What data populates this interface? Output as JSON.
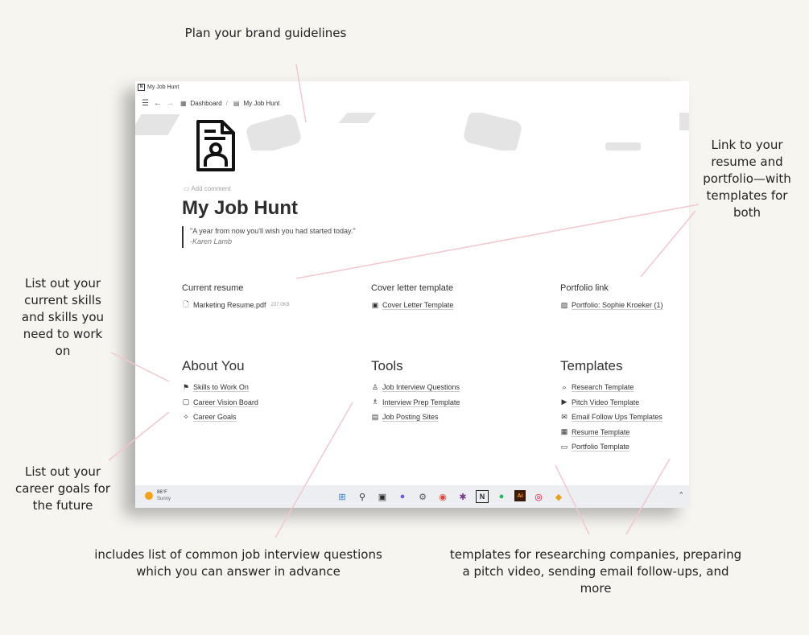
{
  "annotations": {
    "brand": "Plan your brand guidelines",
    "resume_link": "Link to your resume and portfolio—with templates for both",
    "skills": "List out your current skills and skills you need to work on",
    "goals": "List out your career goals for the future",
    "interview": "includes list of common job interview questions which you can answer in advance",
    "templates": "templates for researching companies, preparing a pitch video, sending email follow-ups, and more"
  },
  "window": {
    "title": "My Job Hunt",
    "breadcrumb": [
      "Dashboard",
      "/",
      "My Job Hunt"
    ],
    "add_comment": "Add comment",
    "page_title": "My Job Hunt",
    "quote": "\"A year from now you'll wish you had started today.\"",
    "quote_author": "-Karen Lamb"
  },
  "top_sections": [
    {
      "heading": "Current resume",
      "link": "Marketing Resume.pdf",
      "size": "237.0KB",
      "icon": "pdf-file-icon"
    },
    {
      "heading": "Cover letter template",
      "link": "Cover Letter Template",
      "icon": "id-card-icon"
    },
    {
      "heading": "Portfolio link",
      "link": "Portfolio: Sophie Kroeker (1)",
      "icon": "portfolio-icon"
    }
  ],
  "about": {
    "heading": "About You",
    "items": [
      "Skills to Work On",
      "Career Vision Board",
      "Career Goals"
    ]
  },
  "tools": {
    "heading": "Tools",
    "items": [
      "Job Interview Questions",
      "Interview Prep Template",
      "Job Posting Sites"
    ]
  },
  "templates": {
    "heading": "Templates",
    "items": [
      "Research Template",
      "Pitch Video Template",
      "Email Follow Ups Templates",
      "Resume Template",
      "Portfolio Template"
    ]
  },
  "taskbar": {
    "temp": "86°F",
    "condition": "Sunny"
  },
  "colors": {
    "annotation_line": "#f2c7cf",
    "taskbar": "#eceef2",
    "background": "#f7f5f0"
  }
}
